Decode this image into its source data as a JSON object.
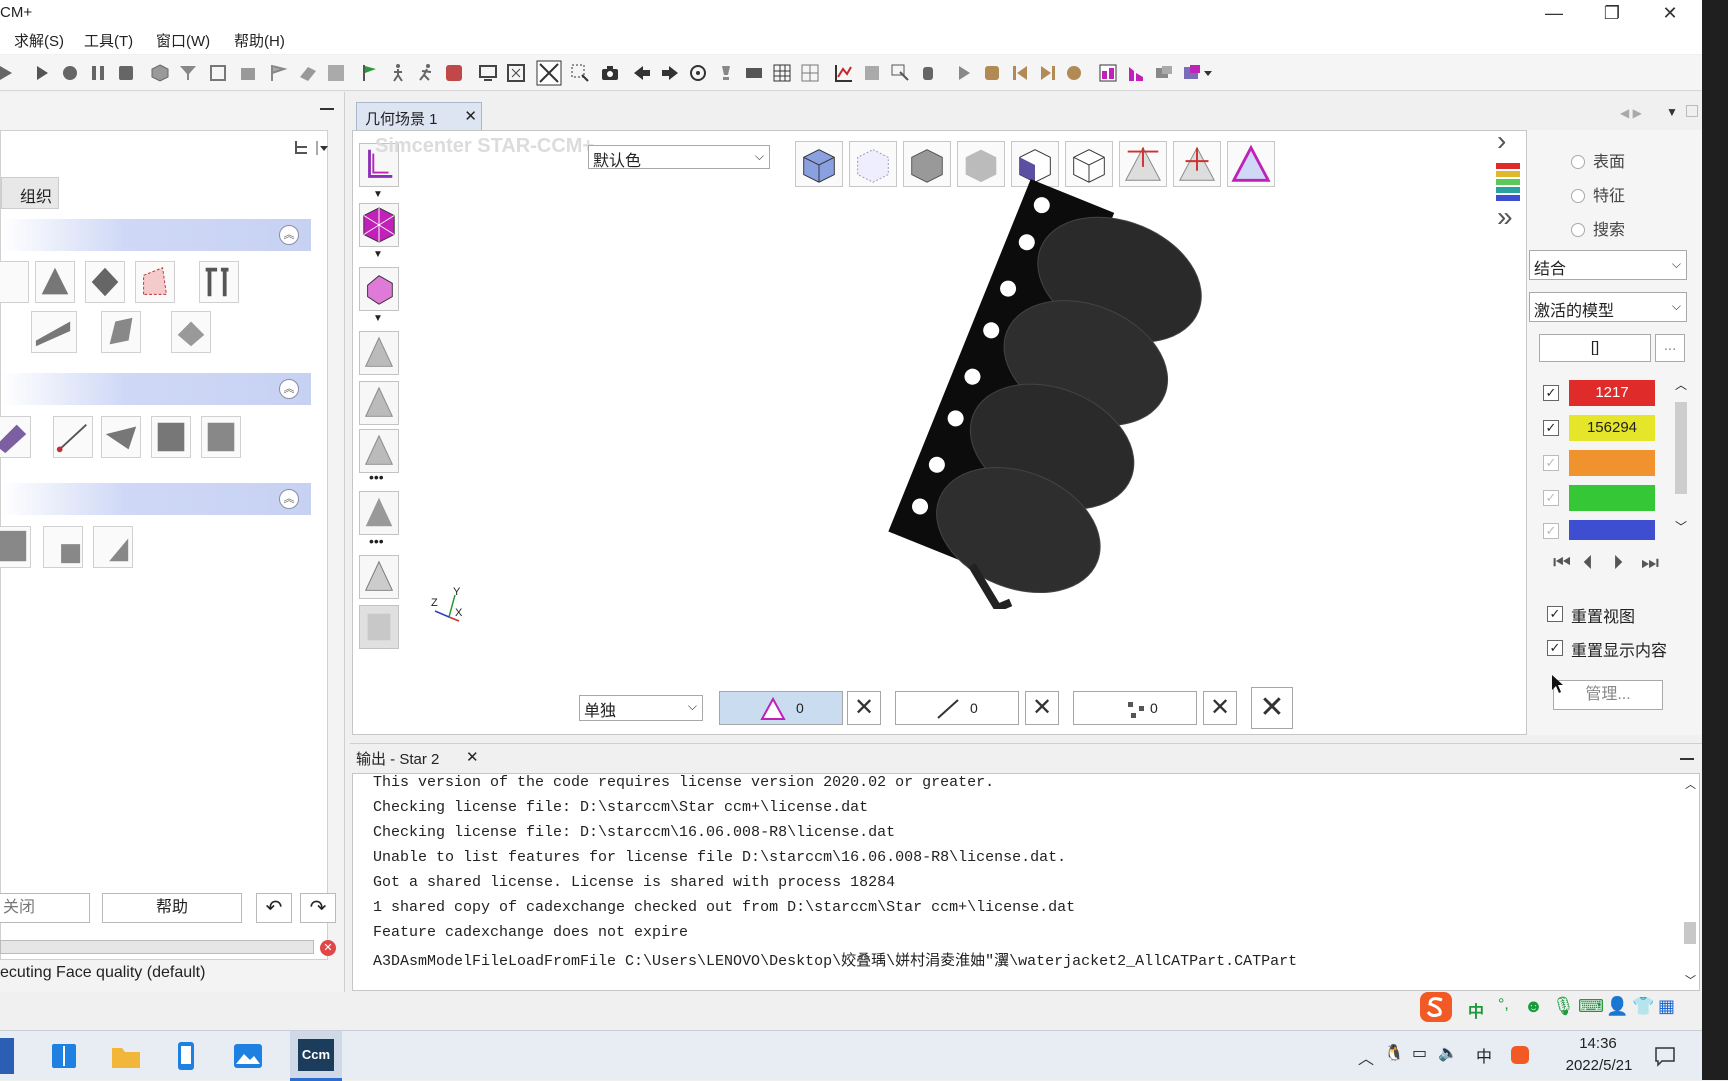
{
  "window": {
    "title": "CM+"
  },
  "menu": [
    "求解(S)",
    "工具(T)",
    "窗口(W)",
    "帮助(H)"
  ],
  "left_panel": {
    "tab_label": "组织",
    "close_button": "关闭",
    "help_button": "帮助",
    "status_text": "ecuting Face quality (default)"
  },
  "scene": {
    "tab_label": "几何场景 1",
    "watermark": "Simcenter STAR-CCM+",
    "color_select": "默认色",
    "mode_select": "单独",
    "face_count": "0",
    "edge_count": "0",
    "vertex_count": "0"
  },
  "right_panel": {
    "radio_options": [
      "表面",
      "特征",
      "搜索"
    ],
    "combine_select": "结合",
    "model_select": "激活的模型",
    "bracket_value": "[]",
    "ellipsis": "...",
    "swatches": [
      {
        "label": "1217",
        "color": "#e02b2b",
        "checked": true
      },
      {
        "label": "156294",
        "color": "#e5e52a",
        "checked": true
      },
      {
        "label": "",
        "color": "#f0922e",
        "checked": true
      },
      {
        "label": "",
        "color": "#35c735",
        "checked": true
      },
      {
        "label": "",
        "color": "#3d4fd0",
        "checked": true
      }
    ],
    "reset_view": "重置视图",
    "reset_content": "重置显示内容",
    "manage_button": "管理..."
  },
  "output": {
    "tab_label": "输出 - Star 2",
    "lines": [
      "This version of the code requires license version 2020.02 or greater.",
      "Checking license file: D:\\starccm\\Star ccm+\\license.dat",
      "Checking license file: D:\\starccm\\16.06.008-R8\\license.dat",
      "Unable to list features for license file D:\\starccm\\16.06.008-R8\\license.dat.",
      "Got a shared license. License is shared with process 18284",
      "1 shared copy of cadexchange checked out from D:\\starccm\\Star ccm+\\license.dat",
      "Feature cadexchange does not expire",
      "A3DAsmModelFileLoadFromFile C:\\Users\\LENOVO\\Desktop\\姣叠瑀\\姘村涓夌淮妯″瀷\\waterjacket2_AllCATPart.CATPart"
    ]
  },
  "axis_labels": {
    "x": "X",
    "y": "Y",
    "z": "Z"
  },
  "ime": {
    "lang": "中"
  },
  "taskbar": {
    "time": "14:36",
    "date": "2022/5/21",
    "app_label": "Ccm",
    "lang": "中"
  }
}
